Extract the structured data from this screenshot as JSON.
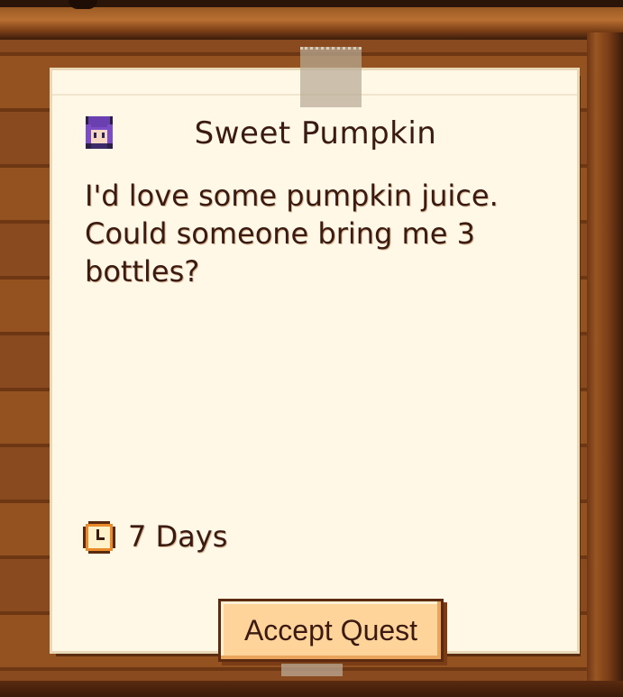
{
  "quest": {
    "title": "Sweet Pumpkin",
    "description": "I'd love some pumpkin juice. Could someone bring me 3 bottles?",
    "time_remaining": "7 Days",
    "accept_label": "Accept Quest"
  },
  "icons": {
    "portrait": "villager-portrait-icon",
    "timer": "clock-icon"
  },
  "colors": {
    "paper": "#fff8e6",
    "text": "#3b1a12",
    "button_fill": "#ffd49a",
    "board_wood": "#8a4a1f"
  }
}
